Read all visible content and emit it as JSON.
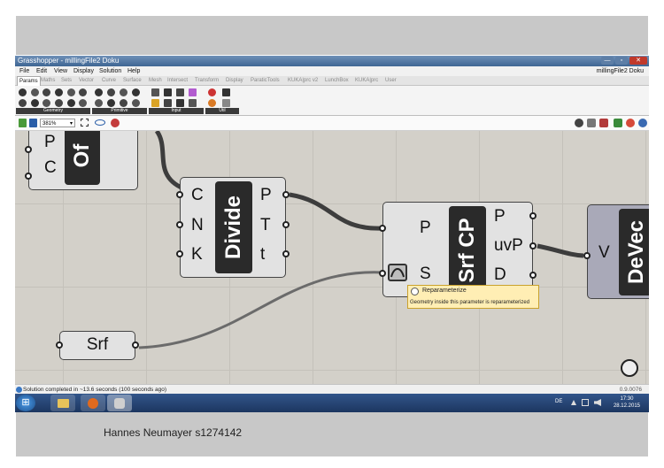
{
  "window": {
    "title": "Grasshopper - millingFile2 Doku",
    "document_name": "millingFile2 Doku",
    "controls": {
      "minimize": "—",
      "maximize": "▫",
      "close": "✕"
    }
  },
  "menu": [
    "File",
    "Edit",
    "View",
    "Display",
    "Solution",
    "Help"
  ],
  "tabs": [
    "Params",
    "Maths",
    "Sets",
    "Vector",
    "Curve",
    "Surface",
    "Mesh",
    "Intersect",
    "Transform",
    "Display",
    "ParaticTools",
    "KUKA|prc v2",
    "LunchBox",
    "KUKA|prc",
    "User"
  ],
  "active_tab": "Params",
  "ribbon_groups": [
    "Geometry",
    "Primitive",
    "Input",
    "Util"
  ],
  "toolbar": {
    "zoom": "381%",
    "zoom_caret": "▾"
  },
  "components": {
    "offset": {
      "nickname": "Of",
      "inputs": [
        "P",
        "C"
      ]
    },
    "divide": {
      "nickname": "Divide",
      "inputs": [
        "C",
        "N",
        "K"
      ],
      "outputs": [
        "P",
        "T",
        "t"
      ]
    },
    "srf_cp": {
      "nickname": "Srf CP",
      "inputs": [
        "P",
        "S"
      ],
      "outputs": [
        "P",
        "uvP",
        "D"
      ]
    },
    "devec": {
      "nickname": "DeVec",
      "inputs": [
        "V"
      ]
    },
    "srf_param": {
      "label": "Srf"
    }
  },
  "tooltip": {
    "title": "Reparameterize",
    "body": "Geometry inside this parameter is reparameterized"
  },
  "status": {
    "text": "Solution completed in ~13.6 seconds (100 seconds ago)",
    "version": "0.9.0076"
  },
  "taskbar": {
    "lang": "DE",
    "time": "17:30",
    "date": "28.12.2015",
    "start_glyph": "⊞"
  },
  "caption": "Hannes Neumayer s1274142",
  "colors": {
    "canvas": "#d3d0c9",
    "component": "#e2e2e2",
    "nickname": "#2a2a2a",
    "tooltip": "#ffeeb4",
    "taskbar": "#1c3660"
  }
}
